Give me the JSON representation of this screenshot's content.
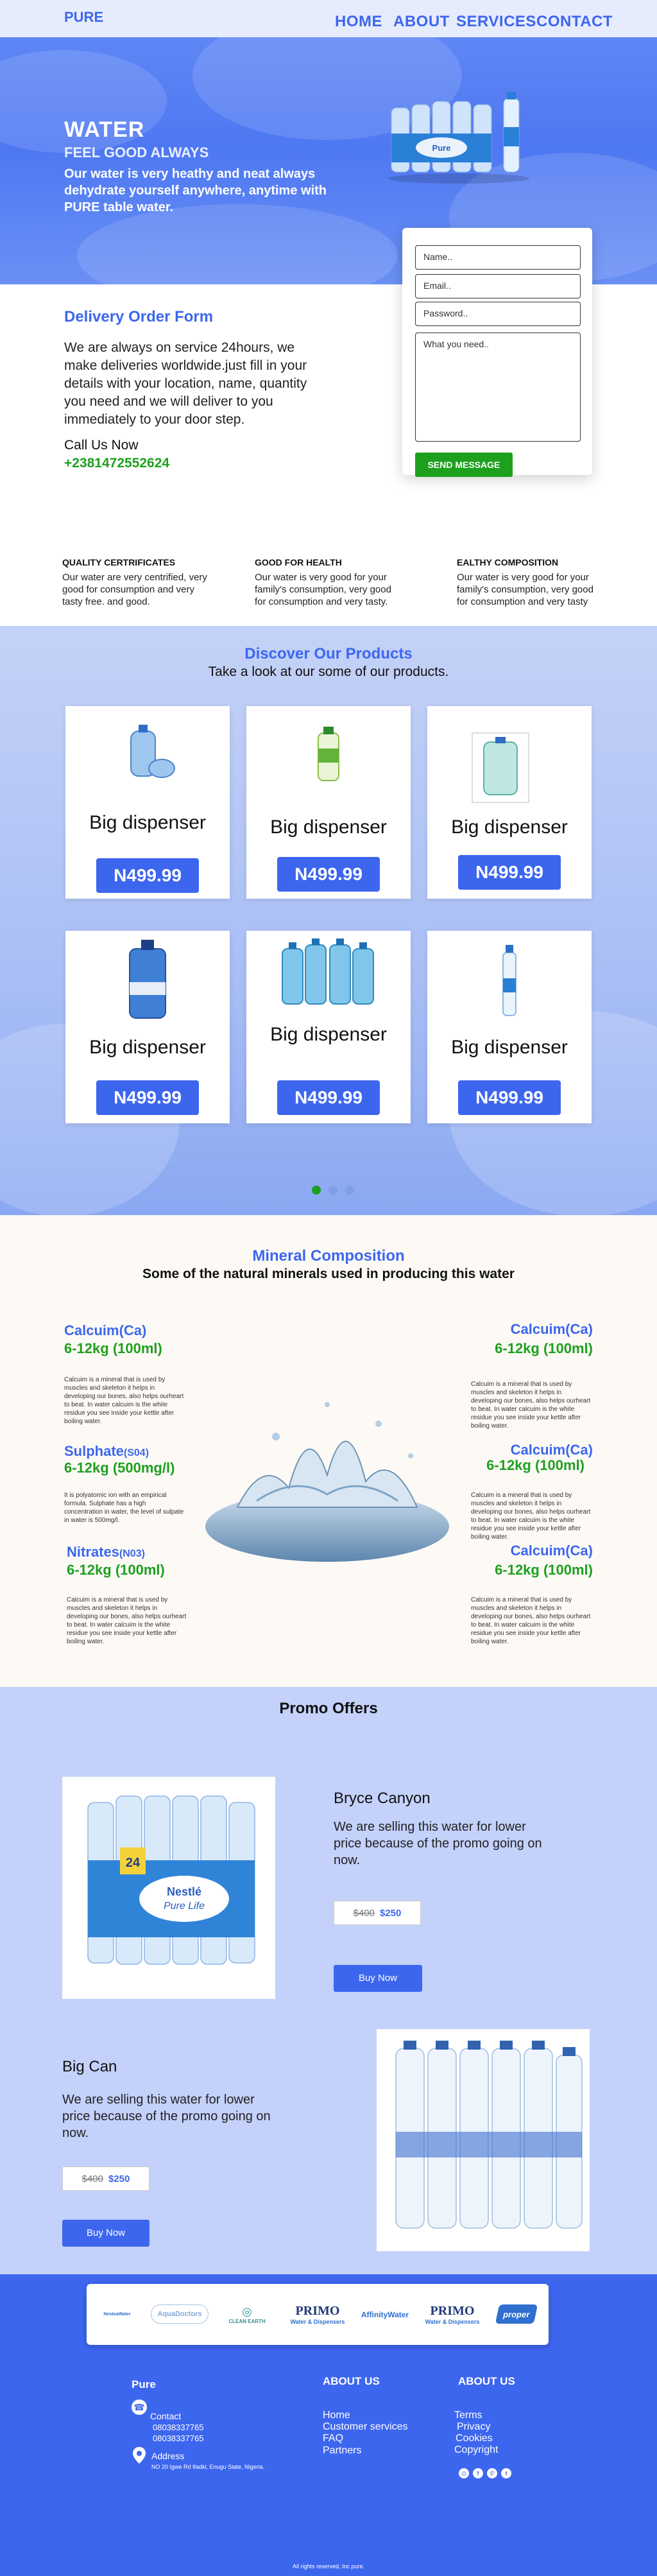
{
  "nav": {
    "logo": "PURE",
    "links": [
      "HOME",
      "ABOUT",
      "SERVICES",
      "CONTACT"
    ]
  },
  "hero": {
    "title": "WATER",
    "subtitle": "FEEL GOOD ALWAYS",
    "text": "Our water is very heathy and neat always dehydrate yourself anywhere, anytime with PURE table water."
  },
  "form": {
    "name_placeholder": "Name..",
    "email_placeholder": "Email..",
    "password_placeholder": "Password..",
    "message_placeholder": "What you need..",
    "send_label": "SEND MESSAGE"
  },
  "delivery": {
    "title": "Delivery Order Form",
    "text": "We are always on service 24hours, we make deliveries worldwide.just fill in your details with your location, name, quantity you need and we will deliver to you immediately to your door step.",
    "call_label": "Call Us Now",
    "phone": "+2381472552624"
  },
  "features": [
    {
      "title": "QUALITY CERTRIFICATES",
      "text": "Our water are very centrified, very good for consumption and very tasty free. and good."
    },
    {
      "title": "GOOD FOR HEALTH",
      "text": "Our water is very good for your family's consumption, very good for consumption and very tasty."
    },
    {
      "title": "EALTHY COMPOSITION",
      "text": "Our water is very good for your family's consumption, very good for consumption and very tasty"
    }
  ],
  "products": {
    "title": "Discover Our Products",
    "subtitle": "Take a look at our some of our products.",
    "items": [
      {
        "name": "Big dispenser",
        "price": "N499.99",
        "icon": "water-jug-icon"
      },
      {
        "name": "Big dispenser",
        "price": "N499.99",
        "icon": "small-bottle-icon"
      },
      {
        "name": "Big dispenser",
        "price": "N499.99",
        "icon": "dispenser-bottle-icon"
      },
      {
        "name": "Big dispenser",
        "price": "N499.99",
        "icon": "gallon-jug-icon"
      },
      {
        "name": "Big dispenser",
        "price": "N499.99",
        "icon": "jug-pack-icon"
      },
      {
        "name": "Big dispenser",
        "price": "N499.99",
        "icon": "tall-bottle-icon"
      }
    ],
    "carousel_active": 0,
    "colors": {
      "accent": "#3d66ef",
      "active_dot": "#1ea01e"
    }
  },
  "minerals": {
    "title": "Mineral Composition",
    "subtitle": "Some of the natural minerals used in producing this water",
    "left": [
      {
        "name": "Calcuim",
        "symbol": "(Ca)",
        "value": "6-12kg (100ml)",
        "desc": "Calcuim is a mineral that is used by muscles and skeleton it helps in developing our bones, also helps ourheart to beat. In water calcuim is the white residue you see inside your kettle after boiling water."
      },
      {
        "name": "Sulphate",
        "symbol": "(S04)",
        "value": "6-12kg (500mg/l)",
        "desc": "It is polyatomic ion with an empirical formula. Sulphate has a high concentration in water, the level of sulpate in water is 500mg/l."
      },
      {
        "name": "Nitrates",
        "symbol": "(N03)",
        "value": "6-12kg (100ml)",
        "desc": "Calcuim is a mineral that is used by muscles and skeleton it helps in developing our bones, also helps ourheart to beat. In water calcuim is the white residue you see inside your kettle after boiling water."
      }
    ],
    "right": [
      {
        "name": "Calcuim",
        "symbol": "(Ca)",
        "value": "6-12kg (100ml)",
        "desc": "Calcuim is a mineral that is used by muscles and skeleton it helps in developing our bones, also helps ourheart to beat. In water calcuim is the white residue you see inside your kettle after boiling water."
      },
      {
        "name": "Calcuim",
        "symbol": "(Ca)",
        "value": "6-12kg (100ml)",
        "desc": "Calcuim is a mineral that is used by muscles and skeleton it helps in developing our bones, also helps ourheart to beat. In water calcuim is the white residue you see inside your kettle after boiling water."
      },
      {
        "name": "Calcuim",
        "symbol": "(Ca)",
        "value": "6-12kg (100ml)",
        "desc": "Calcuim is a mineral that is used by muscles and skeleton it helps in developing our bones, also helps ourheart to beat. In water calcuim is the white residue you see inside your kettle after boiling water."
      }
    ]
  },
  "promo": {
    "title": "Promo Offers",
    "items": [
      {
        "name": "Bryce Canyon",
        "desc": "We are selling this water for lower price because of the promo going on now.",
        "old_price": "$400",
        "new_price": "$250",
        "buy_label": "Buy Now",
        "pack_label": "24",
        "pack_brand": "Nestlé",
        "pack_product": "Pure Life"
      },
      {
        "name": "Big Can",
        "desc": "We are selling this water for lower price because of the promo going on now.",
        "old_price": "$400",
        "new_price": "$250",
        "buy_label": "Buy Now"
      }
    ]
  },
  "brands": [
    "NesteaWater",
    "AquaDoctors",
    "CLEAN EARTH",
    "PRIMO",
    "Water & Dispensers",
    "AffinityWater",
    "PRIMO",
    "Water & Dispensers",
    "proper"
  ],
  "footer": {
    "brand": "Pure",
    "contact_label": "Contact",
    "phones": [
      "08038337765",
      "08038337765"
    ],
    "address_label": "Address",
    "address": "NO 20 Igwe Rd Ifadkl, Enugu State, Nigeria.",
    "about1_title": "ABOUT US",
    "about1_links": [
      "Home",
      "Customer services",
      "FAQ",
      "Partners"
    ],
    "about2_title": "ABOUT US",
    "about2_links": [
      "Terms",
      "Privacy",
      "Cookies",
      "Copyright"
    ],
    "social_icons": [
      "instagram-icon",
      "facebook-icon",
      "whatsapp-icon",
      "twitter-icon"
    ],
    "copyright": "All rights reserved, Inc pure."
  }
}
